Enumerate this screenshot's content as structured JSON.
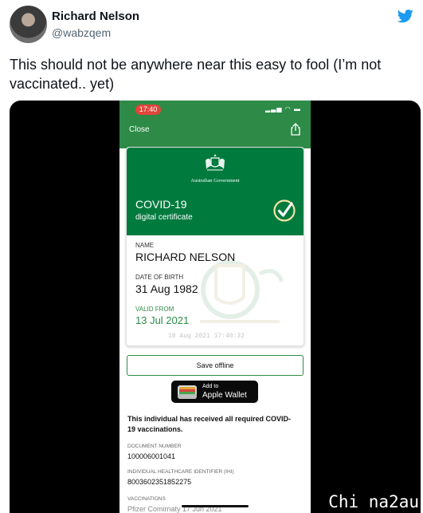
{
  "tweet": {
    "author_name": "Richard Nelson",
    "author_handle": "@wabzqem",
    "text": "This should not be anywhere near this easy to fool (I’m not vaccinated.. yet)"
  },
  "phone": {
    "status_time": "17:40",
    "close_label": "Close",
    "certificate": {
      "government": "Australian Government",
      "title": "COVID-19",
      "subtitle": "digital certificate",
      "name_label": "NAME",
      "name_value": "RICHARD NELSON",
      "dob_label": "DATE OF BIRTH",
      "dob_value": "31 Aug 1982",
      "valid_from_label": "VALID FROM",
      "valid_from_value": "13 Jul 2021",
      "timestamp": "18 Aug 2021 17:40:32"
    },
    "save_offline_label": "Save offline",
    "wallet_button": {
      "add_to": "Add to",
      "name": "Apple Wallet"
    },
    "received_text": "This individual has received all required COVID-19 vaccinations.",
    "document_number_label": "DOCUMENT NUMBER",
    "document_number_value": "100006001041",
    "ihi_label": "INDIVIDUAL HEALTHCARE IDENTIFIER (IHI)",
    "ihi_value": "8003602351852275",
    "vaccinations_label": "VACCINATIONS",
    "vaccinations_partial": "Pfizer Comirnaty 17 Jun 2021"
  },
  "site_watermark": "Chi na2au",
  "colors": {
    "green": "#2e8b47",
    "cert_green": "#007a3d",
    "twitter_blue": "#1d9bf0"
  }
}
